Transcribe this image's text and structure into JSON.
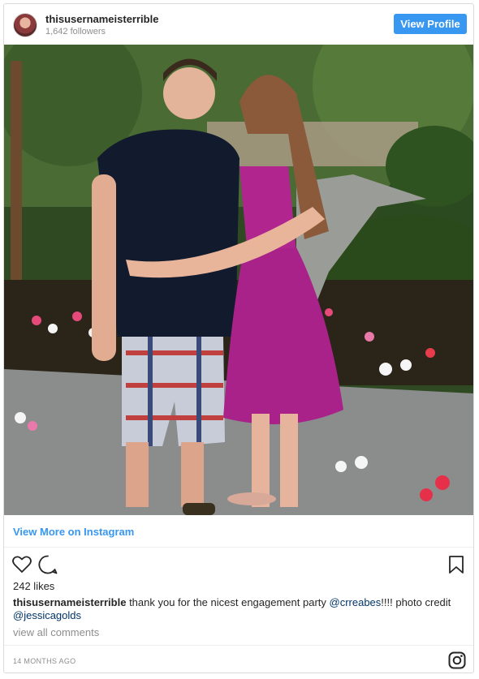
{
  "header": {
    "username": "thisusernameisterrible",
    "followers": "1,642 followers",
    "view_profile_label": "View Profile"
  },
  "photo": {
    "description_icon": "post-photo"
  },
  "link": {
    "view_more": "View More on Instagram"
  },
  "actions": {
    "like_icon": "heart-icon",
    "comment_icon": "comment-icon",
    "save_icon": "bookmark-icon"
  },
  "likes": "242 likes",
  "caption": {
    "user": "thisusernameisterrible",
    "text_before": " thank you for the nicest engagement party ",
    "mention1": "@crreabes",
    "text_middle": "!!!! photo credit ",
    "mention2": "@jessicagolds"
  },
  "view_all_comments": "view all comments",
  "footer": {
    "timestamp": "14 MONTHS AGO",
    "logo_icon": "instagram-icon"
  },
  "colors": {
    "accent": "#3897f0",
    "text": "#262626",
    "muted": "#8e8e8e",
    "mention": "#003569"
  }
}
